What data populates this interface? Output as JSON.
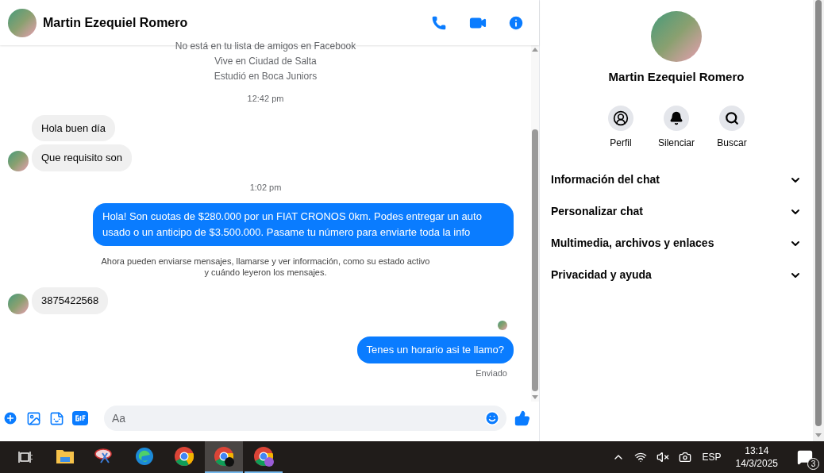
{
  "header": {
    "name": "Martin Ezequiel Romero"
  },
  "messages": [
    {
      "kind": "info",
      "text": "No está en tu lista de amigos en Facebook"
    },
    {
      "kind": "info",
      "text": "Vive en Ciudad de Salta"
    },
    {
      "kind": "info",
      "text": "Estudió en Boca Juniors"
    },
    {
      "kind": "time",
      "text": "12:42 pm"
    },
    {
      "kind": "incoming",
      "text": "Hola buen día",
      "avatar": false
    },
    {
      "kind": "incoming",
      "text": "Que requisito son",
      "avatar": true
    },
    {
      "kind": "time",
      "text": "1:02 pm"
    },
    {
      "kind": "outgoing",
      "text": "Hola! Son cuotas de $280.000 por un FIAT CRONOS 0km. Podes entregar un auto usado o un anticipo de $3.500.000. Pasame tu número para enviarte toda la info"
    },
    {
      "kind": "notice",
      "text": "Ahora pueden enviarse mensajes, llamarse y ver información, como su estado activo y cuándo leyeron los mensajes."
    },
    {
      "kind": "incoming",
      "text": "3875422568",
      "avatar": true
    },
    {
      "kind": "seen"
    },
    {
      "kind": "outgoing",
      "text": "Tenes un horario asi te llamo?"
    },
    {
      "kind": "status",
      "text": "Enviado"
    }
  ],
  "composer": {
    "placeholder": "Aa"
  },
  "panel": {
    "name": "Martin Ezequiel Romero",
    "actions": [
      {
        "kind": "profile",
        "label": "Perfil"
      },
      {
        "kind": "mute",
        "label": "Silenciar"
      },
      {
        "kind": "search",
        "label": "Buscar"
      }
    ],
    "sections": [
      {
        "label": "Información del chat",
        "expanded": false
      },
      {
        "label": "Personalizar chat",
        "expanded": false
      },
      {
        "label": "Multimedia, archivos y enlaces",
        "expanded": false
      },
      {
        "label": "Privacidad y ayuda",
        "expanded": false
      }
    ]
  },
  "taskbar": {
    "language": "ESP",
    "time": "13:14",
    "date": "14/3/2025",
    "notifications": "3",
    "apps": [
      {
        "kind": "explorer",
        "selected": false
      },
      {
        "kind": "snip",
        "selected": false
      },
      {
        "kind": "edge",
        "selected": false
      },
      {
        "kind": "chrome",
        "selected": false
      },
      {
        "kind": "chrome-profile",
        "selected": true
      },
      {
        "kind": "chrome-lock",
        "selected": false
      }
    ]
  }
}
